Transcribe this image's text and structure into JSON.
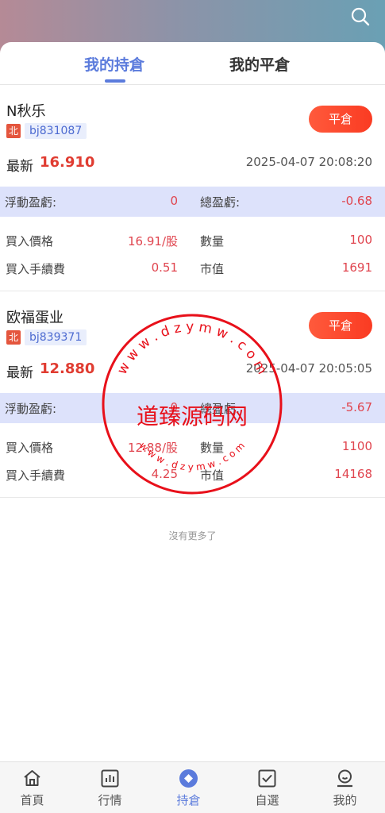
{
  "header": {
    "search_icon": "search-icon"
  },
  "tabs": [
    {
      "label": "我的持倉",
      "active": true
    },
    {
      "label": "我的平倉",
      "active": false
    }
  ],
  "positions": [
    {
      "name": "N秋乐",
      "exchange_badge": "北",
      "code": "bj831087",
      "close_label": "平倉",
      "latest_label": "最新",
      "latest_value": "16.910",
      "time": "2025-04-07 20:08:20",
      "floating_pl_label": "浮動盈虧:",
      "floating_pl_value": "0",
      "total_pl_label": "總盈虧:",
      "total_pl_value": "-0.68",
      "buy_price_label": "買入價格",
      "buy_price_value": "16.91/股",
      "quantity_label": "數量",
      "quantity_value": "100",
      "fee_label": "買入手續費",
      "fee_value": "0.51",
      "market_value_label": "市值",
      "market_value_value": "1691"
    },
    {
      "name": "欧福蛋业",
      "exchange_badge": "北",
      "code": "bj839371",
      "close_label": "平倉",
      "latest_label": "最新",
      "latest_value": "12.880",
      "time": "2025-04-07 20:05:05",
      "floating_pl_label": "浮動盈虧:",
      "floating_pl_value": "0",
      "total_pl_label": "總盈虧:",
      "total_pl_value": "-5.67",
      "buy_price_label": "買入價格",
      "buy_price_value": "12.88/股",
      "quantity_label": "數量",
      "quantity_value": "1100",
      "fee_label": "買入手續費",
      "fee_value": "4.25",
      "market_value_label": "市值",
      "market_value_value": "14168"
    }
  ],
  "no_more_text": "沒有更多了",
  "watermark": {
    "main_text": "道臻源码网",
    "ring_text_top": "w w w . d z y m w . c o m",
    "ring_text_bottom": "w w w . d z y m w . c o m"
  },
  "bottom_nav": [
    {
      "label": "首頁",
      "icon": "home-icon",
      "active": false
    },
    {
      "label": "行情",
      "icon": "chart-icon",
      "active": false
    },
    {
      "label": "持倉",
      "icon": "holdings-icon",
      "active": true
    },
    {
      "label": "自選",
      "icon": "watchlist-icon",
      "active": false
    },
    {
      "label": "我的",
      "icon": "profile-icon",
      "active": false
    }
  ],
  "colors": {
    "accent": "#5b7bdc",
    "danger": "#e03c31",
    "button": "#fa3b22",
    "pl_row_bg": "#dde2fb"
  }
}
